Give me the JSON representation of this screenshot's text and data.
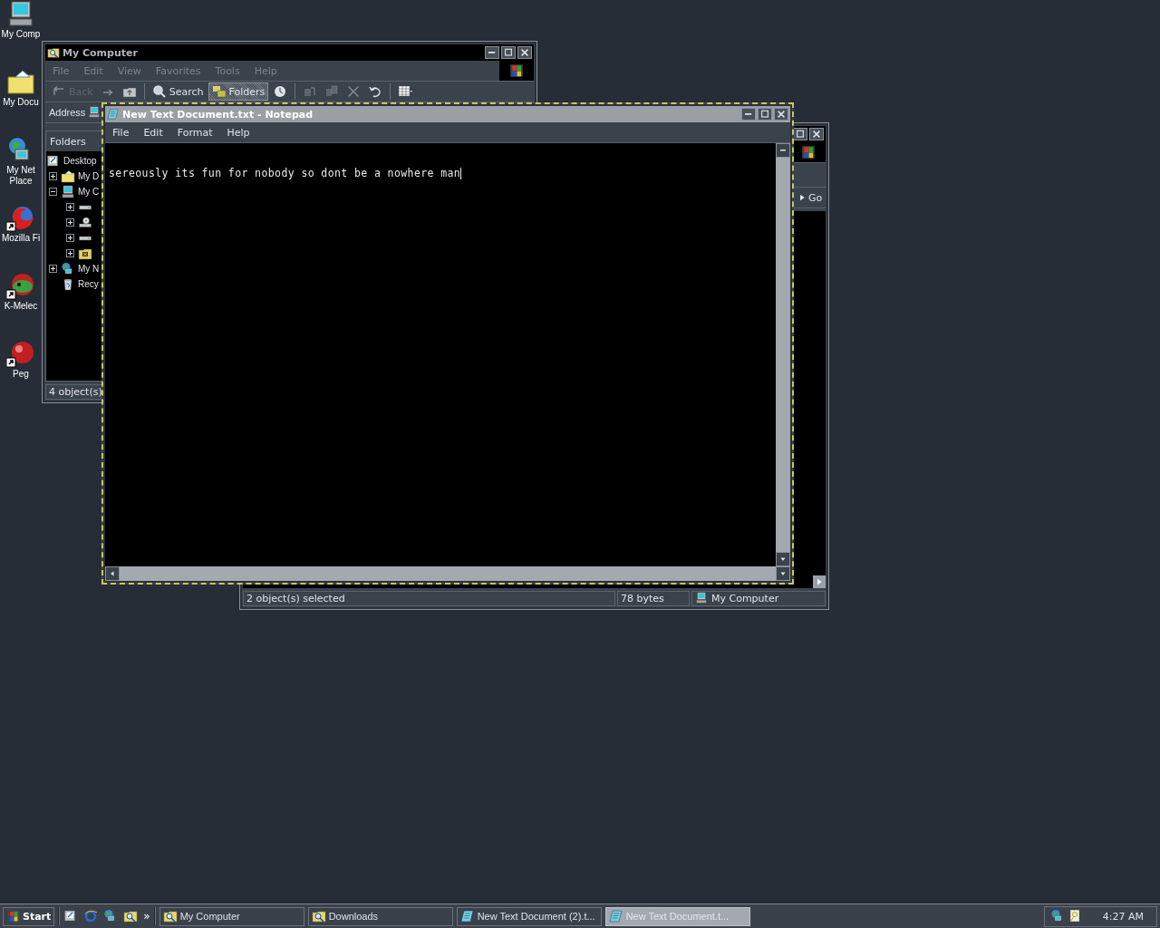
{
  "desktop_icons": [
    {
      "kind": "computer",
      "label": [
        "My Comp"
      ]
    },
    {
      "kind": "documents",
      "label": [
        "My Docu"
      ]
    },
    {
      "kind": "network",
      "label": [
        "My Net",
        "Place"
      ]
    },
    {
      "kind": "firefox",
      "label": [
        "Mozilla Fi"
      ]
    },
    {
      "kind": "kmeleon",
      "label": [
        "K-Melec"
      ]
    },
    {
      "kind": "pegasus",
      "label": [
        "Peg"
      ]
    }
  ],
  "explorer": {
    "title": "My Computer",
    "menu": [
      {
        "label": "File",
        "disabled": true
      },
      {
        "label": "Edit",
        "disabled": true
      },
      {
        "label": "View",
        "disabled": true
      },
      {
        "label": "Favorites",
        "disabled": true
      },
      {
        "label": "Tools",
        "disabled": true
      },
      {
        "label": "Help",
        "disabled": true
      }
    ],
    "toolbar": [
      {
        "kind": "back",
        "label": "Back",
        "disabled": true
      },
      {
        "kind": "forward",
        "disabled": true
      },
      {
        "kind": "up",
        "disabled": false
      },
      {
        "kind": "search",
        "label": "Search",
        "selected": false
      },
      {
        "kind": "folders",
        "label": "Folders",
        "selected": true
      },
      {
        "kind": "history",
        "disabled": false
      },
      {
        "kind": "move",
        "disabled": true
      },
      {
        "kind": "copy",
        "disabled": true
      },
      {
        "kind": "delete",
        "disabled": true
      },
      {
        "kind": "undo",
        "disabled": false
      },
      {
        "kind": "views",
        "disabled": false
      }
    ],
    "address_label": "Address",
    "folders_title": "Folders",
    "tree": [
      {
        "label": "Desktop",
        "kind": "desktop",
        "children": [
          {
            "label": "My D",
            "kind": "documents",
            "expanded": false
          },
          {
            "label": "My C",
            "kind": "computer",
            "expanded": true,
            "children": [
              {
                "kind": "drive",
                "expanded": false
              },
              {
                "kind": "cdrom",
                "expanded": false
              },
              {
                "kind": "drive",
                "expanded": false
              },
              {
                "kind": "control",
                "expanded": false
              }
            ]
          },
          {
            "label": "My N",
            "kind": "network",
            "expanded": false
          },
          {
            "label": "Recy",
            "kind": "recycle"
          }
        ]
      }
    ],
    "status": "4 object(s)"
  },
  "downloads": {
    "go": "Go",
    "status": [
      "2 object(s) selected",
      "78 bytes",
      "My Computer"
    ]
  },
  "notepad": {
    "title": "New Text Document.txt - Notepad",
    "menu": [
      "File",
      "Edit",
      "Format",
      "Help"
    ],
    "text": "sereously its fun for nobody so dont be a nowhere man"
  },
  "taskbar": {
    "start": "Start",
    "quick_launch": [
      {
        "kind": "desktop"
      },
      {
        "kind": "ie"
      },
      {
        "kind": "network"
      },
      {
        "kind": "explorer"
      }
    ],
    "overflow": "»",
    "tasks": [
      {
        "kind": "explorer",
        "label": "My Computer",
        "selected": false
      },
      {
        "kind": "explorer",
        "label": "Downloads",
        "selected": false
      },
      {
        "kind": "notepad",
        "label": "New Text Document (2).t...",
        "selected": false
      },
      {
        "kind": "notepad",
        "label": "New Text Document.t...",
        "selected": true
      }
    ],
    "tray": [
      {
        "kind": "network"
      },
      {
        "kind": "key"
      }
    ],
    "clock": "4:27 AM"
  }
}
